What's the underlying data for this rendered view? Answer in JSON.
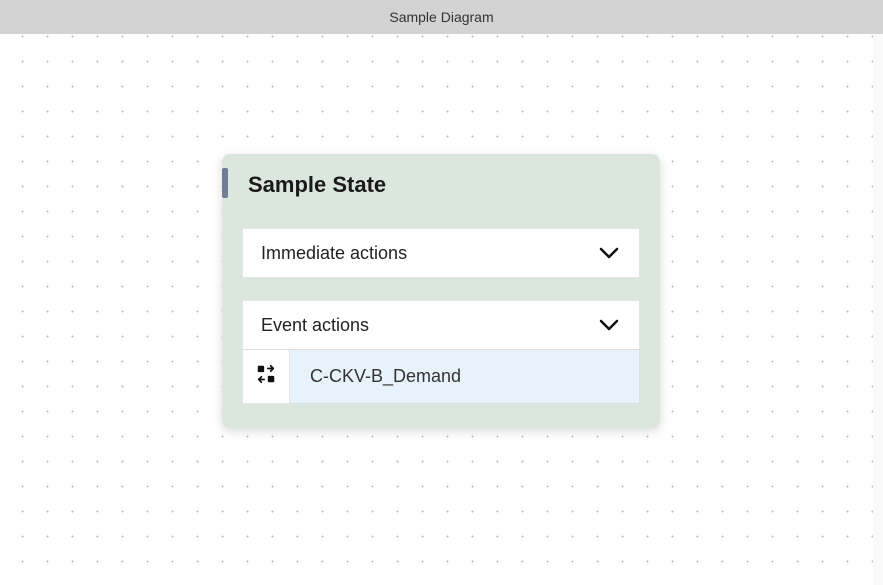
{
  "titlebar": {
    "title": "Sample Diagram"
  },
  "state": {
    "title": "Sample State",
    "sections": {
      "immediate": {
        "label": "Immediate actions"
      },
      "event": {
        "label": "Event actions",
        "items": [
          {
            "label": "C-CKV-B_Demand"
          }
        ]
      }
    }
  }
}
